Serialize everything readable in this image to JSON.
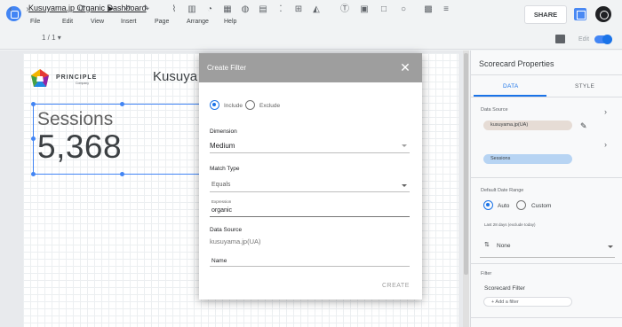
{
  "app": {
    "doc_title": "Kusuyama.jp Organic Dashboard",
    "menu": [
      "File",
      "Edit",
      "View",
      "Insert",
      "Page",
      "Arrange",
      "Help"
    ],
    "share_label": "SHARE",
    "page_indicator": "1 / 1 ▾",
    "edit_label": "Edit"
  },
  "report": {
    "brand_name": "PRINCIPLE",
    "brand_sub": "Company",
    "title": "Kusuya",
    "scorecard": {
      "label": "Sessions",
      "value": "5,368"
    }
  },
  "modal": {
    "title": "Create Filter",
    "close": "✕",
    "include_label": "Include",
    "exclude_label": "Exclude",
    "dimension_label": "Dimension",
    "dimension_value": "Medium",
    "match_type_label": "Match Type",
    "match_type_value": "Equals",
    "expression_label": "Expression",
    "expression_value": "organic",
    "data_source_label": "Data Source",
    "data_source_value": "kusuyama.jp(UA)",
    "name_label": "Name",
    "create_label": "CREATE"
  },
  "panel": {
    "title": "Scorecard Properties",
    "tabs": [
      "DATA",
      "STYLE"
    ],
    "data_source_label": "Data Source",
    "data_source_chip": "kusuyama.jp(UA)",
    "metric_chip": "Sessions",
    "date_range_label": "Default Date Range",
    "auto_label": "Auto",
    "custom_label": "Custom",
    "date_hint": "Last 28 days (exclude today)",
    "sort_value": "None",
    "filter_label": "Filter",
    "scorecard_filter_label": "Scorecard Filter",
    "add_filter_label": "+ Add a filter"
  },
  "colors": {
    "accent": "#1a73e8",
    "modal_header": "#9e9e9e",
    "metric_chip": "#b7d4f3",
    "data_source_chip": "#e6dcd5"
  }
}
